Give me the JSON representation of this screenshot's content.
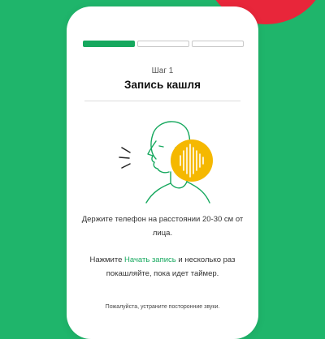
{
  "colors": {
    "background": "#1fb56b",
    "accent_green": "#16a85e",
    "accent_yellow": "#f5b800",
    "decor_red": "#e8263a"
  },
  "progress": {
    "segments": 3,
    "completed": 1
  },
  "step_label": "Шаг 1",
  "title": "Запись кашля",
  "illustration": {
    "person_icon": "coughing-person-icon",
    "sound_icon": "sound-wave-icon"
  },
  "instruction1": "Держите телефон на расстоянии 20-30 см от лица.",
  "instruction2": {
    "before": "Нажмите ",
    "link": "Начать запись",
    "after": " и несколько раз покашляйте, пока идет таймер."
  },
  "note": "Пожалуйста, устраните посторонние звуки."
}
